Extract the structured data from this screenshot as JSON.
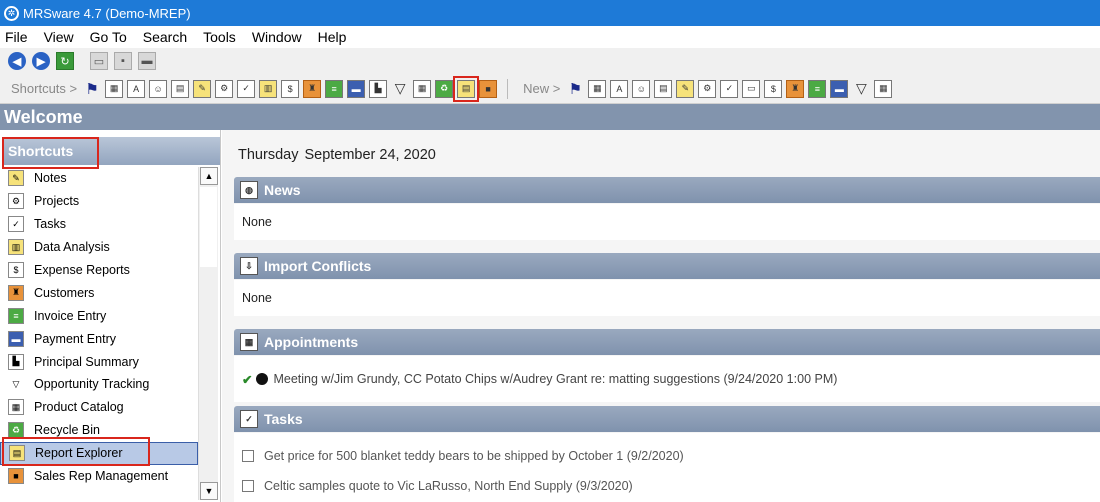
{
  "window": {
    "title": "MRSware 4.7 (Demo-MREP)"
  },
  "menu": [
    "File",
    "View",
    "Go To",
    "Search",
    "Tools",
    "Window",
    "Help"
  ],
  "toolbar": {
    "shortcuts_label": "Shortcuts >",
    "new_label": "New >"
  },
  "welcome": {
    "title": "Welcome"
  },
  "shortcuts": {
    "header": "Shortcuts",
    "items": [
      {
        "label": "Notes",
        "icon": "note-icon"
      },
      {
        "label": "Projects",
        "icon": "projects-icon"
      },
      {
        "label": "Tasks",
        "icon": "task-icon"
      },
      {
        "label": "Data Analysis",
        "icon": "data-analysis-icon"
      },
      {
        "label": "Expense Reports",
        "icon": "expense-icon"
      },
      {
        "label": "Customers",
        "icon": "customers-icon"
      },
      {
        "label": "Invoice Entry",
        "icon": "invoice-icon"
      },
      {
        "label": "Payment Entry",
        "icon": "payment-icon"
      },
      {
        "label": "Principal Summary",
        "icon": "principal-icon"
      },
      {
        "label": "Opportunity Tracking",
        "icon": "funnel-icon"
      },
      {
        "label": "Product Catalog",
        "icon": "catalog-icon"
      },
      {
        "label": "Recycle Bin",
        "icon": "recycle-bin-icon"
      },
      {
        "label": "Report Explorer",
        "icon": "report-explorer-icon"
      },
      {
        "label": "Sales Rep Management",
        "icon": "sales-rep-icon"
      }
    ]
  },
  "main": {
    "date_day": "Thursday",
    "date_full": "September 24, 2020",
    "news": {
      "title": "News",
      "body": "None"
    },
    "import_conflicts": {
      "title": "Import Conflicts",
      "body": "None"
    },
    "appointments": {
      "title": "Appointments",
      "items": [
        "Meeting w/Jim Grundy, CC Potato Chips w/Audrey Grant re: matting suggestions (9/24/2020 1:00 PM)"
      ]
    },
    "tasks": {
      "title": "Tasks",
      "items": [
        "Get price for 500 blanket teddy bears to be shipped by October 1 (9/2/2020)",
        "Celtic samples  quote to Vic LaRusso, North End Supply (9/3/2020)"
      ]
    }
  }
}
